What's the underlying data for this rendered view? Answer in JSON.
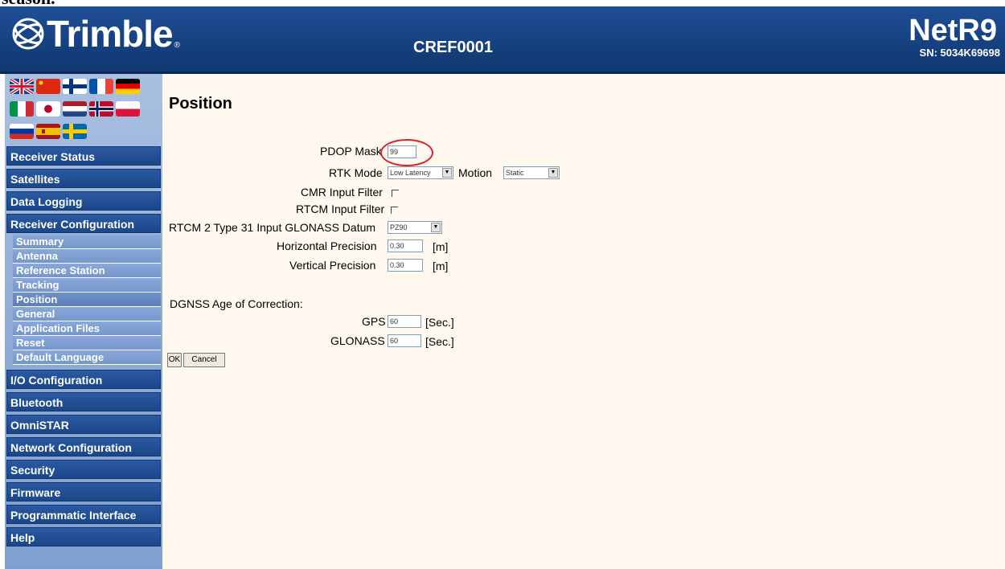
{
  "fragment": "season.",
  "header": {
    "logo_text": "Trimble",
    "logo_reg": "®",
    "device_name": "CREF0001",
    "product": "NetR9",
    "serial": "SN: 5034K69698"
  },
  "languages": [
    {
      "name": "english-uk",
      "icon": "flag-uk"
    },
    {
      "name": "chinese",
      "icon": "flag-china"
    },
    {
      "name": "finnish",
      "icon": "flag-finland"
    },
    {
      "name": "french",
      "icon": "flag-france"
    },
    {
      "name": "german",
      "icon": "flag-germany"
    },
    {
      "name": "italian",
      "icon": "flag-italy"
    },
    {
      "name": "japanese",
      "icon": "flag-japan"
    },
    {
      "name": "dutch",
      "icon": "flag-netherlands"
    },
    {
      "name": "norwegian",
      "icon": "flag-norway"
    },
    {
      "name": "polish",
      "icon": "flag-poland"
    },
    {
      "name": "russian",
      "icon": "flag-russia"
    },
    {
      "name": "spanish",
      "icon": "flag-spain"
    },
    {
      "name": "swedish",
      "icon": "flag-sweden"
    }
  ],
  "nav": {
    "receiver_status": "Receiver Status",
    "satellites": "Satellites",
    "data_logging": "Data Logging",
    "receiver_configuration": "Receiver Configuration",
    "sub": {
      "summary": "Summary",
      "antenna": "Antenna",
      "reference_station": "Reference Station",
      "tracking": "Tracking",
      "position": "Position",
      "general": "General",
      "application_files": "Application Files",
      "reset": "Reset",
      "default_language": "Default Language"
    },
    "io_configuration": "I/O Configuration",
    "bluetooth": "Bluetooth",
    "omnistar": "OmniSTAR",
    "network_configuration": "Network Configuration",
    "security": "Security",
    "firmware": "Firmware",
    "programmatic_interface": "Programmatic Interface",
    "help": "Help"
  },
  "page": {
    "title": "Position",
    "pdop_mask_label": "PDOP Mask",
    "pdop_mask_value": "99",
    "rtk_mode_label": "RTK Mode",
    "rtk_mode_value": "Low Latency",
    "motion_label": "Motion",
    "motion_value": "Static",
    "cmr_input_filter_label": "CMR Input Filter",
    "rtcm_input_filter_label": "RTCM Input Filter",
    "rtcm2_datum_label": "RTCM 2 Type 31 Input GLONASS Datum",
    "rtcm2_datum_value": "PZ90",
    "horizontal_precision_label": "Horizontal Precision",
    "horizontal_precision_value": "0.30",
    "horizontal_precision_unit": "[m]",
    "vertical_precision_label": "Vertical Precision",
    "vertical_precision_value": "0.30",
    "vertical_precision_unit": "[m]",
    "dgnss_heading": "DGNSS Age of Correction:",
    "gps_label": "GPS",
    "gps_value": "60",
    "gps_unit": "[Sec.]",
    "glonass_label": "GLONASS",
    "glonass_value": "60",
    "glonass_unit": "[Sec.]",
    "ok_label": "OK",
    "cancel_label": "Cancel"
  },
  "colors": {
    "header_bg": "#1a4485",
    "sidebar_bg": "#90acd6",
    "nav_item_bg": "#1f4b8e",
    "content_bg": "#fff8ee",
    "highlight": "#d8202a"
  }
}
